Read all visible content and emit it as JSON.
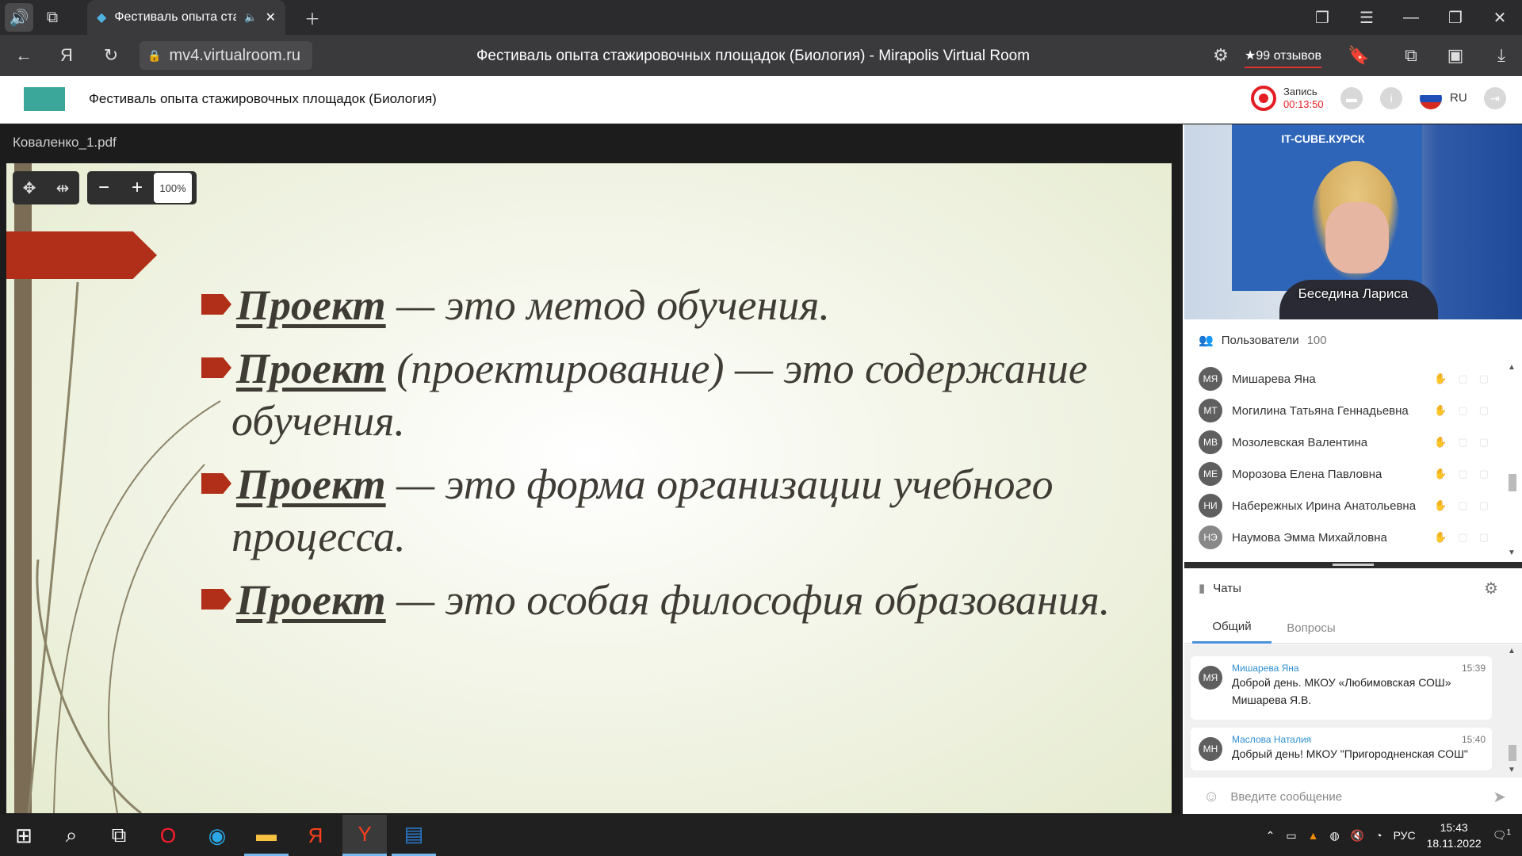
{
  "browser": {
    "tab_title": "Фестиваль опыта ста",
    "url": "mv4.virtualroom.ru",
    "page_title": "Фестиваль опыта стажировочных площадок (Биология) - Mirapolis Virtual Room",
    "reviews": "★99 отзывов"
  },
  "app": {
    "title": "Фестиваль опыта стажировочных площадок (Биология)",
    "rec_label": "Запись",
    "rec_time": "00:13:50",
    "lang": "RU",
    "accent_color": "#e31e24"
  },
  "presentation": {
    "file_name": "Коваленко_1.pdf",
    "zoom": "100%",
    "lines": [
      {
        "kw": "Проект",
        "rest": " — это метод обучения."
      },
      {
        "kw": "Проект",
        "rest": " (проектирование) — это содержание"
      },
      {
        "kw": "",
        "rest": "обучения."
      },
      {
        "kw": "Проект",
        "rest": " — это форма организации учебного"
      },
      {
        "kw": "",
        "rest": "процесса."
      },
      {
        "kw": "Проект",
        "rest": " — это особая философия образования."
      }
    ]
  },
  "video": {
    "sign": "IT-CUBE.КУРСК",
    "speaker": "Беседина Лариса"
  },
  "users": {
    "label": "Пользователи",
    "count": "100",
    "list": [
      {
        "initials": "МЯ",
        "name": "Мишарева Яна"
      },
      {
        "initials": "МТ",
        "name": "Могилина Татьяна Геннадьевна"
      },
      {
        "initials": "МВ",
        "name": "Мозолевская Валентина"
      },
      {
        "initials": "МЕ",
        "name": "Морозова Елена Павловна"
      },
      {
        "initials": "НИ",
        "name": "Набережных Ирина Анатольевна"
      },
      {
        "initials": "НЭ",
        "name": "Наумова Эмма Михайловна"
      }
    ]
  },
  "chats": {
    "label": "Чаты",
    "tabs": [
      "Общий",
      "Вопросы"
    ],
    "messages": [
      {
        "initials": "МЯ",
        "author": "Мишарева Яна",
        "time": "15:39",
        "text": "Доброй день. МКОУ «Любимовская СОШ» Мишарева Я.В."
      },
      {
        "initials": "МН",
        "author": "Маслова Наталия",
        "time": "15:40",
        "text": "Добрый день! МКОУ \"Пригородненская СОШ\""
      }
    ],
    "input_placeholder": "Введите сообщение"
  },
  "taskbar": {
    "lang": "РУС",
    "time": "15:43",
    "date": "18.11.2022",
    "notif_count": "1"
  }
}
